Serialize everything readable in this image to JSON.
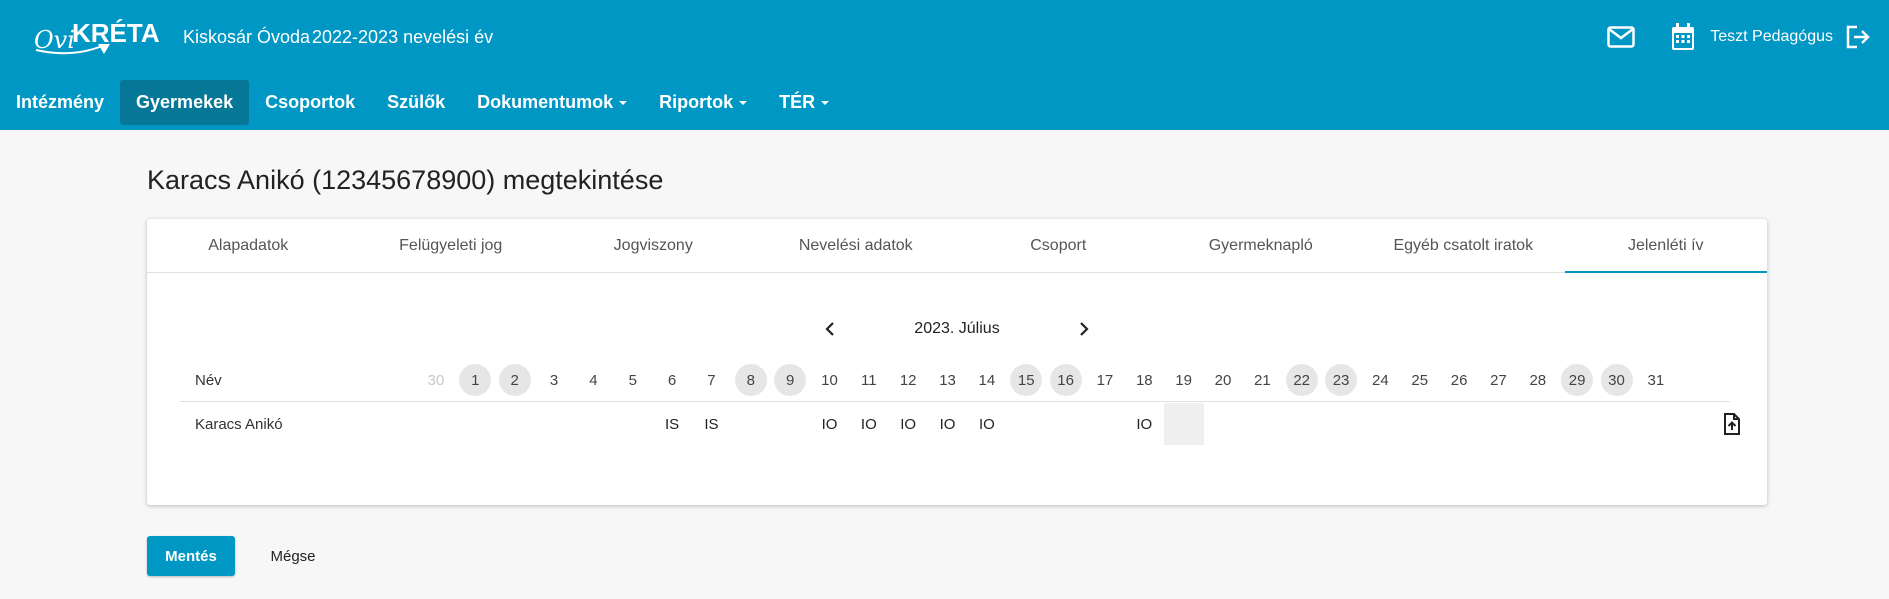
{
  "header": {
    "logo_text": "OviKRÉTA",
    "institution": "Kiskosár Óvoda",
    "school_year": "2022-2023 nevelési év",
    "user_name": "Teszt Pedagógus",
    "icons": [
      "mail-icon",
      "calendar-icon",
      "logout-icon"
    ]
  },
  "nav": {
    "items": [
      {
        "label": "Intézmény",
        "dropdown": false
      },
      {
        "label": "Gyermekek",
        "dropdown": false,
        "active": true
      },
      {
        "label": "Csoportok",
        "dropdown": false
      },
      {
        "label": "Szülők",
        "dropdown": false
      },
      {
        "label": "Dokumentumok",
        "dropdown": true
      },
      {
        "label": "Riportok",
        "dropdown": true
      },
      {
        "label": "TÉR",
        "dropdown": true
      }
    ]
  },
  "page": {
    "title": "Karacs Anikó (12345678900) megtekintése"
  },
  "tabs": [
    {
      "label": "Alapadatok"
    },
    {
      "label": "Felügyeleti jog"
    },
    {
      "label": "Jogviszony"
    },
    {
      "label": "Nevelési adatok"
    },
    {
      "label": "Csoport"
    },
    {
      "label": "Gyermeknapló"
    },
    {
      "label": "Egyéb csatolt iratok"
    },
    {
      "label": "Jelenléti ív",
      "active": true
    }
  ],
  "calendar": {
    "month_label": "2023. Július",
    "name_header": "Név",
    "days": [
      {
        "label": "30",
        "muted": true,
        "weekend": false
      },
      {
        "label": "1",
        "weekend": true
      },
      {
        "label": "2",
        "weekend": true
      },
      {
        "label": "3",
        "weekend": false
      },
      {
        "label": "4",
        "weekend": false
      },
      {
        "label": "5",
        "weekend": false
      },
      {
        "label": "6",
        "weekend": false
      },
      {
        "label": "7",
        "weekend": false
      },
      {
        "label": "8",
        "weekend": true
      },
      {
        "label": "9",
        "weekend": true
      },
      {
        "label": "10",
        "weekend": false
      },
      {
        "label": "11",
        "weekend": false
      },
      {
        "label": "12",
        "weekend": false
      },
      {
        "label": "13",
        "weekend": false
      },
      {
        "label": "14",
        "weekend": false
      },
      {
        "label": "15",
        "weekend": true
      },
      {
        "label": "16",
        "weekend": true
      },
      {
        "label": "17",
        "weekend": false
      },
      {
        "label": "18",
        "weekend": false
      },
      {
        "label": "19",
        "weekend": false
      },
      {
        "label": "20",
        "weekend": false
      },
      {
        "label": "21",
        "weekend": false
      },
      {
        "label": "22",
        "weekend": true
      },
      {
        "label": "23",
        "weekend": true
      },
      {
        "label": "24",
        "weekend": false
      },
      {
        "label": "25",
        "weekend": false
      },
      {
        "label": "26",
        "weekend": false
      },
      {
        "label": "27",
        "weekend": false
      },
      {
        "label": "28",
        "weekend": false
      },
      {
        "label": "29",
        "weekend": true
      },
      {
        "label": "30",
        "weekend": true
      },
      {
        "label": "31",
        "weekend": false
      }
    ],
    "rows": [
      {
        "name": "Karacs Anikó",
        "marks": [
          "",
          "",
          "",
          "",
          "",
          "",
          "IS",
          "IS",
          "",
          "",
          "IO",
          "IO",
          "IO",
          "IO",
          "IO",
          "",
          "",
          "",
          "IO",
          "",
          "",
          "",
          "",
          "",
          "",
          "",
          "",
          "",
          "",
          "",
          "",
          ""
        ],
        "today_index": 19
      }
    ]
  },
  "actions": {
    "save_label": "Mentés",
    "cancel_label": "Mégse"
  },
  "colors": {
    "primary": "#0097c4",
    "nav_active": "#077797",
    "background": "#f7f7f7"
  }
}
